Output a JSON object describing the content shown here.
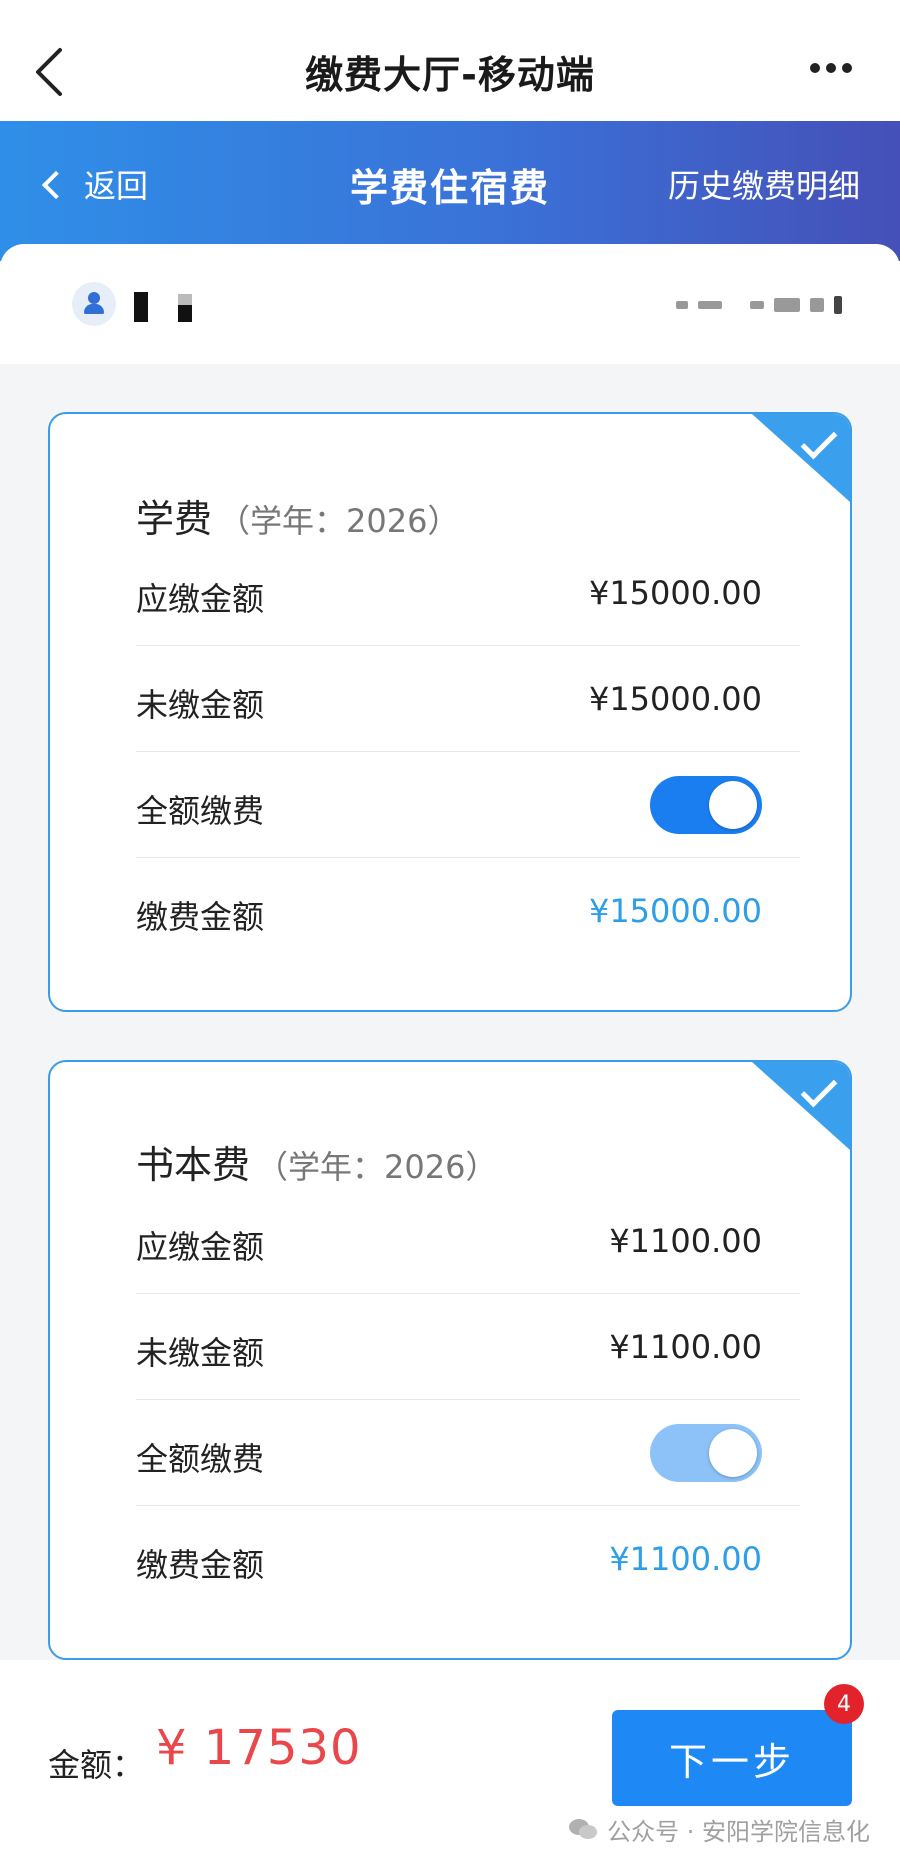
{
  "topbar": {
    "title": "缴费大厅-移动端",
    "back_icon": "chevron-left-icon",
    "more_icon": "more-horizontal-icon"
  },
  "header": {
    "back_label": "返回",
    "title": "学费住宿费",
    "history_label": "历史缴费明细",
    "gradient_start": "#2f8fe8",
    "gradient_end": "#4550b8"
  },
  "user": {
    "avatar_icon": "user-icon"
  },
  "fees": [
    {
      "name": "学费",
      "year_note": "（学年：2026）",
      "rows": {
        "due_label": "应缴金额",
        "due_value": "¥15000.00",
        "unpaid_label": "未缴金额",
        "unpaid_value": "¥15000.00",
        "full_label": "全额缴费",
        "pay_label": "缴费金额",
        "pay_value": "¥15000.00"
      },
      "selected": true,
      "full_payment_on": true
    },
    {
      "name": "书本费",
      "year_note": "（学年：2026）",
      "rows": {
        "due_label": "应缴金额",
        "due_value": "¥1100.00",
        "unpaid_label": "未缴金额",
        "unpaid_value": "¥1100.00",
        "full_label": "全额缴费",
        "pay_label": "缴费金额",
        "pay_value": "¥1100.00"
      },
      "selected": true,
      "full_payment_on": true
    }
  ],
  "footer": {
    "amount_label": "金额：",
    "amount_value": "¥ 17530",
    "next_label": "下一步",
    "badge_count": "4",
    "watermark": "公众号 · 安阳学院信息化",
    "accent_color": "#1e88f5",
    "amount_color": "#e9474b"
  }
}
